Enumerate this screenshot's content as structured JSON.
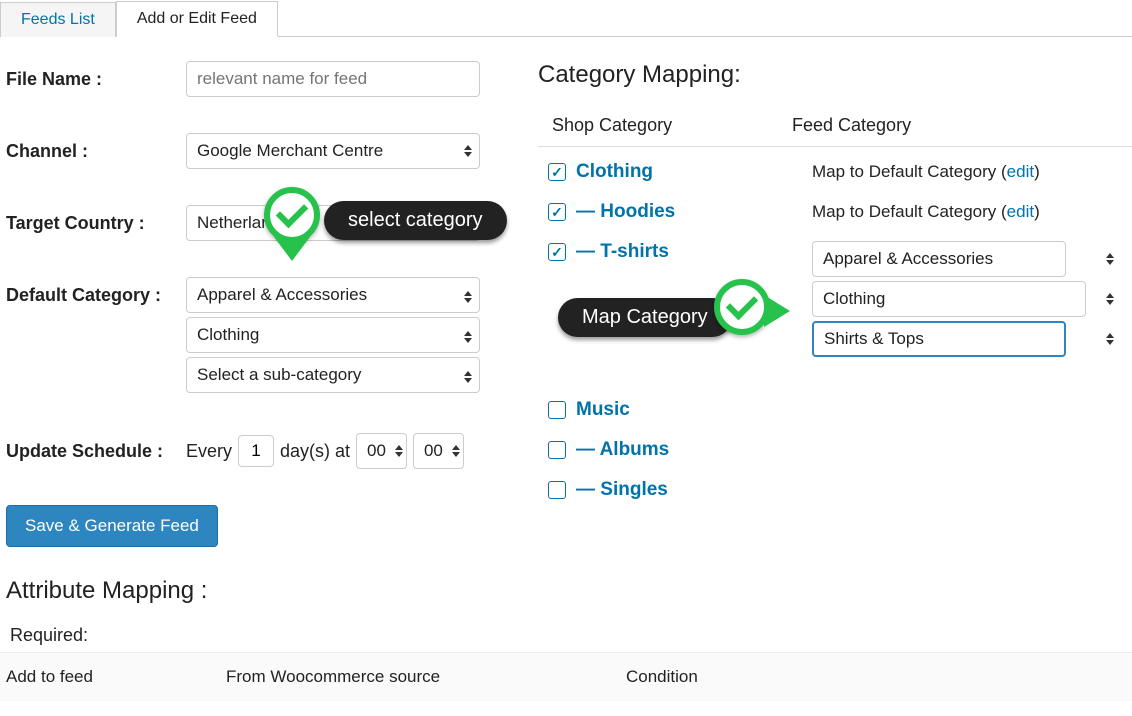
{
  "tabs": {
    "feeds_list": "Feeds List",
    "add_edit": "Add or Edit Feed"
  },
  "form": {
    "file_name_label": "File Name :",
    "file_name_placeholder": "relevant name for feed",
    "channel_label": "Channel :",
    "channel_value": "Google Merchant Centre",
    "target_country_label": "Target Country :",
    "target_country_value": "Netherlan",
    "select_category_tooltip": "select category",
    "default_category_label": "Default Category :",
    "default_cat_1": "Apparel & Accessories",
    "default_cat_2": "Clothing",
    "default_cat_3": "Select a sub-category",
    "update_schedule_label": "Update Schedule :",
    "schedule_every": "Every",
    "schedule_days": "1",
    "schedule_days_at": "day(s) at",
    "schedule_hour": "00",
    "schedule_min": "00",
    "save_button": "Save & Generate Feed"
  },
  "attr": {
    "title": "Attribute Mapping :",
    "required": "Required:",
    "col_add": "Add to feed",
    "col_source": "From Woocommerce source",
    "col_condition": "Condition"
  },
  "catmap": {
    "title": "Category Mapping:",
    "col_shop": "Shop Category",
    "col_feed": "Feed Category",
    "map_default_prefix": "Map to Default Category (",
    "edit_text": "edit",
    "map_default_suffix": ")",
    "map_category_tooltip": "Map Category",
    "items": {
      "clothing": "Clothing",
      "hoodies": "— Hoodies",
      "tshirts": "— T-shirts",
      "music": "Music",
      "albums": "— Albums",
      "singles": "— Singles"
    },
    "tshirt_sel1": "Apparel & Accessories",
    "tshirt_sel2": "Clothing",
    "tshirt_sel3": "Shirts & Tops"
  }
}
